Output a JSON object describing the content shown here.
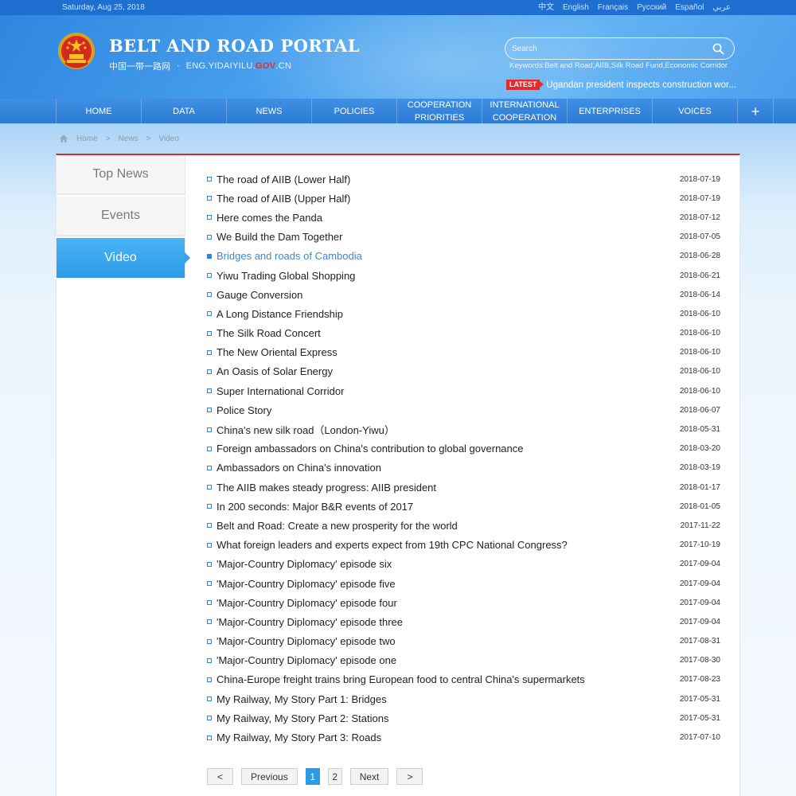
{
  "topbar": {
    "date": "Saturday, Aug 25, 2018",
    "languages": [
      "中文",
      "English",
      "Français",
      "Русский",
      "Español",
      "عربي"
    ]
  },
  "header": {
    "title": "BELT AND ROAD PORTAL",
    "subtitle_cn": "中国一带一路网",
    "subtitle_dot": "·",
    "url_prefix": "ENG.YIDAIYILU.",
    "url_gov": "GOV",
    "url_suffix": ".CN",
    "search_placeholder": "Search",
    "keywords": "Keywords:Belt and Road,AIIB,Silk Road Fund,Economic Corridor",
    "latest_label": "LATEST",
    "latest_news": "Ugandan president inspects construction wor..."
  },
  "nav": {
    "items": [
      "HOME",
      "DATA",
      "NEWS",
      "POLICIES",
      "COOPERATION PRIORITIES",
      "INTERNATIONAL COOPERATION",
      "ENTERPRISES",
      "VOICES"
    ],
    "plus": "+"
  },
  "breadcrumb": [
    "Home",
    ">",
    "News",
    ">",
    "Video"
  ],
  "sidebar": {
    "tabs": [
      "Top News",
      "Events",
      "Video"
    ]
  },
  "list": [
    {
      "title": "The road of AIIB (Lower Half)",
      "date": "2018-07-19"
    },
    {
      "title": "The road of AIIB (Upper Half)",
      "date": "2018-07-19"
    },
    {
      "title": "Here comes the Panda",
      "date": "2018-07-12"
    },
    {
      "title": "We Build the Dam Together",
      "date": "2018-07-05"
    },
    {
      "title": "Bridges and roads of Cambodia",
      "date": "2018-06-28"
    },
    {
      "title": "Yiwu Trading Global Shopping",
      "date": "2018-06-21"
    },
    {
      "title": "Gauge Conversion",
      "date": "2018-06-14"
    },
    {
      "title": "A Long Distance Friendship",
      "date": "2018-06-10"
    },
    {
      "title": "The Silk Road Concert",
      "date": "2018-06-10"
    },
    {
      "title": "The New Oriental Express",
      "date": "2018-06-10"
    },
    {
      "title": "An Oasis of Solar Energy",
      "date": "2018-06-10"
    },
    {
      "title": "Super International Corridor",
      "date": "2018-06-10"
    },
    {
      "title": "Police Story",
      "date": "2018-06-07"
    },
    {
      "title": "China's new silk road（London-Yiwu）",
      "date": "2018-05-31"
    },
    {
      "title": "Foreign ambassadors on China's contribution to global governance",
      "date": "2018-03-20"
    },
    {
      "title": "Ambassadors on China's innovation",
      "date": "2018-03-19"
    },
    {
      "title": "The AIIB makes steady progress: AIIB president",
      "date": "2018-01-17"
    },
    {
      "title": "In 200 seconds: Major B&R events of 2017",
      "date": "2018-01-05"
    },
    {
      "title": "Belt and Road: Create a new prosperity for the world",
      "date": "2017-11-22"
    },
    {
      "title": "What foreign leaders and experts expect from 19th CPC National Congress?",
      "date": "2017-10-19"
    },
    {
      "title": "'Major-Country Diplomacy' episode six",
      "date": "2017-09-04"
    },
    {
      "title": "'Major-Country Diplomacy' episode five",
      "date": "2017-09-04"
    },
    {
      "title": "'Major-Country Diplomacy' episode four",
      "date": "2017-09-04"
    },
    {
      "title": "'Major-Country Diplomacy' episode three",
      "date": "2017-09-04"
    },
    {
      "title": "'Major-Country Diplomacy' episode two",
      "date": "2017-08-31"
    },
    {
      "title": "'Major-Country Diplomacy' episode one",
      "date": "2017-08-30"
    },
    {
      "title": "China-Europe freight trains bring European food to central China's supermarkets",
      "date": "2017-08-23"
    },
    {
      "title": "My Railway, My Story Part 1: Bridges",
      "date": "2017-05-31"
    },
    {
      "title": "My Railway, My Story Part 2: Stations",
      "date": "2017-05-31"
    },
    {
      "title": "My Railway, My Story Part 3: Roads",
      "date": "2017-07-10"
    }
  ],
  "pager": {
    "first": "<",
    "previous": "Previous",
    "pages": [
      "1",
      "2"
    ],
    "next": "Next",
    "last": ">"
  },
  "colors": {
    "accent_blue": "#2d9ae8",
    "header_red": "#d7282a",
    "gov_red": "#e62b2b"
  }
}
